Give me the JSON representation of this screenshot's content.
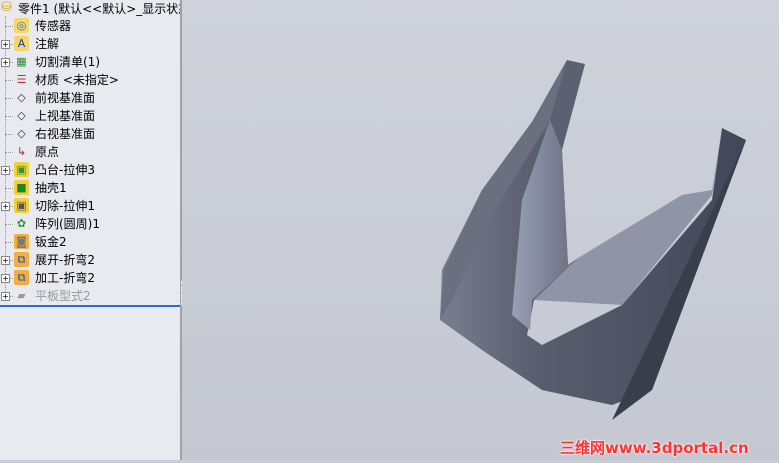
{
  "tree": {
    "root": "零件1 (默认<<默认>_显示状态",
    "items": [
      {
        "label": "传感器",
        "icon": "sensor-folder-icon",
        "expand": false
      },
      {
        "label": "注解",
        "icon": "annotation-folder-icon",
        "expand": true
      },
      {
        "label": "切割清单(1)",
        "icon": "cut-list-icon",
        "expand": true
      },
      {
        "label": "材质 <未指定>",
        "icon": "material-icon",
        "expand": false
      },
      {
        "label": "前视基准面",
        "icon": "plane-icon",
        "expand": false
      },
      {
        "label": "上视基准面",
        "icon": "plane-icon",
        "expand": false
      },
      {
        "label": "右视基准面",
        "icon": "plane-icon",
        "expand": false
      },
      {
        "label": "原点",
        "icon": "origin-icon",
        "expand": false
      },
      {
        "label": "凸台-拉伸3",
        "icon": "boss-extrude-icon",
        "expand": true
      },
      {
        "label": "抽壳1",
        "icon": "shell-icon",
        "expand": false
      },
      {
        "label": "切除-拉伸1",
        "icon": "cut-extrude-icon",
        "expand": true
      },
      {
        "label": "阵列(圆周)1",
        "icon": "circular-pattern-icon",
        "expand": false
      },
      {
        "label": "钣金2",
        "icon": "sheet-metal-icon",
        "expand": false
      },
      {
        "label": "展开-折弯2",
        "icon": "unfold-icon",
        "expand": true
      },
      {
        "label": "加工-折弯2",
        "icon": "process-bend-icon",
        "expand": true
      },
      {
        "label": "平板型式2",
        "icon": "flat-pattern-icon",
        "expand": true,
        "suppressed": true
      }
    ]
  },
  "watermark": "三维网www.3dportal.cn"
}
